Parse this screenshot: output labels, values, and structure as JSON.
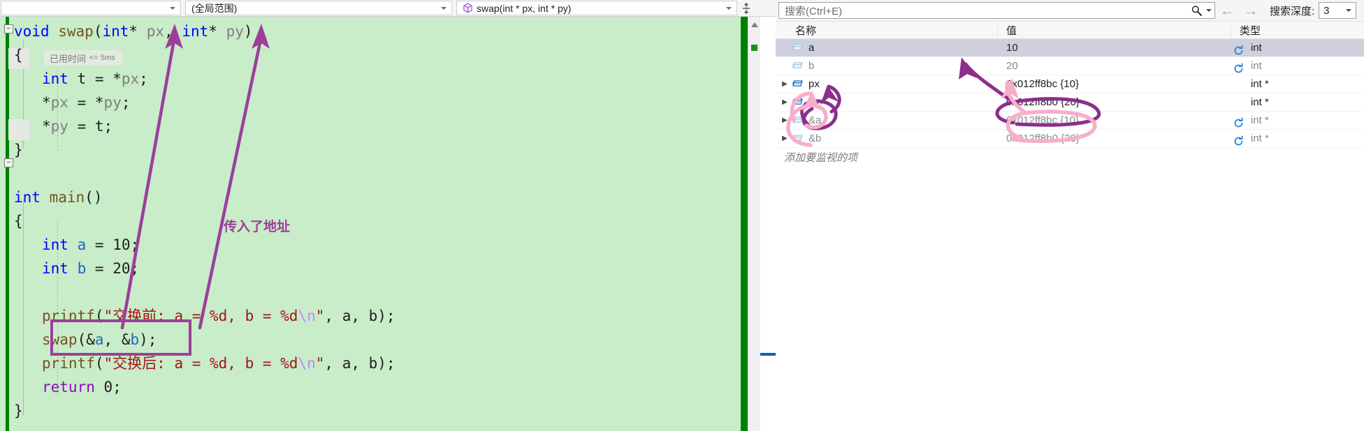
{
  "editor": {
    "nav": {
      "scope_combo_1": "",
      "scope_combo_2": "(全局范围)",
      "function_combo": "swap(int * px, int * py)",
      "cube_icon": "cube-icon",
      "split_icon": "split-window-icon"
    },
    "elapsed": {
      "label": "已用时间",
      "value": "<= 5ms"
    },
    "annotation": "传入了地址",
    "code": [
      {
        "indent": 0,
        "tokens": [
          {
            "t": "void",
            "c": "kw"
          },
          {
            "t": " ",
            "c": "punc"
          },
          {
            "t": "swap",
            "c": "fn"
          },
          {
            "t": "(",
            "c": "punc"
          },
          {
            "t": "int",
            "c": "kw"
          },
          {
            "t": "*",
            "c": "punc"
          },
          {
            "t": " ",
            "c": "punc"
          },
          {
            "t": "px",
            "c": "param"
          },
          {
            "t": ", ",
            "c": "punc"
          },
          {
            "t": "int",
            "c": "kw"
          },
          {
            "t": "*",
            "c": "punc"
          },
          {
            "t": " ",
            "c": "punc"
          },
          {
            "t": "py",
            "c": "param"
          },
          {
            "t": ")",
            "c": "punc"
          }
        ]
      },
      {
        "indent": 0,
        "tokens": [
          {
            "t": "{",
            "c": "punc"
          }
        ]
      },
      {
        "indent": 1,
        "tokens": [
          {
            "t": "int",
            "c": "kw"
          },
          {
            "t": " t = ",
            "c": "punc"
          },
          {
            "t": "*",
            "c": "punc"
          },
          {
            "t": "px",
            "c": "param"
          },
          {
            "t": ";",
            "c": "punc"
          }
        ]
      },
      {
        "indent": 1,
        "tokens": [
          {
            "t": "*",
            "c": "punc"
          },
          {
            "t": "px",
            "c": "param"
          },
          {
            "t": " = ",
            "c": "punc"
          },
          {
            "t": "*",
            "c": "punc"
          },
          {
            "t": "py",
            "c": "param"
          },
          {
            "t": ";",
            "c": "punc"
          }
        ]
      },
      {
        "indent": 1,
        "tokens": [
          {
            "t": "*",
            "c": "punc"
          },
          {
            "t": "py",
            "c": "param"
          },
          {
            "t": " = t;",
            "c": "punc"
          }
        ]
      },
      {
        "indent": 0,
        "tokens": [
          {
            "t": "}",
            "c": "punc"
          }
        ]
      },
      {
        "indent": 0,
        "tokens": []
      },
      {
        "indent": 0,
        "tokens": [
          {
            "t": "int",
            "c": "kw"
          },
          {
            "t": " ",
            "c": "punc"
          },
          {
            "t": "main",
            "c": "fn"
          },
          {
            "t": "()",
            "c": "punc"
          }
        ]
      },
      {
        "indent": 0,
        "tokens": [
          {
            "t": "{",
            "c": "punc"
          }
        ]
      },
      {
        "indent": 1,
        "tokens": [
          {
            "t": "int",
            "c": "kw"
          },
          {
            "t": " ",
            "c": "punc"
          },
          {
            "t": "a",
            "c": "var"
          },
          {
            "t": " = ",
            "c": "punc"
          },
          {
            "t": "10",
            "c": "num"
          },
          {
            "t": ";",
            "c": "punc"
          }
        ]
      },
      {
        "indent": 1,
        "tokens": [
          {
            "t": "int",
            "c": "kw"
          },
          {
            "t": " ",
            "c": "punc"
          },
          {
            "t": "b",
            "c": "var"
          },
          {
            "t": " = ",
            "c": "punc"
          },
          {
            "t": "20",
            "c": "num"
          },
          {
            "t": ";",
            "c": "punc"
          }
        ]
      },
      {
        "indent": 1,
        "tokens": []
      },
      {
        "indent": 1,
        "tokens": [
          {
            "t": "printf",
            "c": "fn"
          },
          {
            "t": "(",
            "c": "punc"
          },
          {
            "t": "\"交换前: a = %d, b = %d",
            "c": "str"
          },
          {
            "t": "\\n",
            "c": "esc"
          },
          {
            "t": "\"",
            "c": "str"
          },
          {
            "t": ", a, b);",
            "c": "punc"
          }
        ]
      },
      {
        "indent": 1,
        "tokens": [
          {
            "t": "swap",
            "c": "fn"
          },
          {
            "t": "(",
            "c": "punc"
          },
          {
            "t": "&",
            "c": "punc"
          },
          {
            "t": "a",
            "c": "var"
          },
          {
            "t": ", ",
            "c": "punc"
          },
          {
            "t": "&",
            "c": "punc"
          },
          {
            "t": "b",
            "c": "var"
          },
          {
            "t": ");",
            "c": "punc"
          }
        ]
      },
      {
        "indent": 1,
        "tokens": [
          {
            "t": "printf",
            "c": "fn"
          },
          {
            "t": "(",
            "c": "punc"
          },
          {
            "t": "\"交换后: a = %d, b = %d",
            "c": "str"
          },
          {
            "t": "\\n",
            "c": "esc"
          },
          {
            "t": "\"",
            "c": "str"
          },
          {
            "t": ", a, b);",
            "c": "punc"
          }
        ]
      },
      {
        "indent": 1,
        "tokens": [
          {
            "t": "return",
            "c": "ctrl"
          },
          {
            "t": " ",
            "c": "punc"
          },
          {
            "t": "0",
            "c": "num"
          },
          {
            "t": ";",
            "c": "punc"
          }
        ]
      },
      {
        "indent": 0,
        "tokens": [
          {
            "t": "}",
            "c": "punc"
          }
        ]
      }
    ]
  },
  "watch": {
    "search": {
      "placeholder": "搜索(Ctrl+E)",
      "icon": "magnifier-icon"
    },
    "nav_back": "←",
    "nav_forward": "→",
    "depth_label": "搜索深度:",
    "depth_value": "3",
    "columns": {
      "name": "名称",
      "value": "值",
      "type": "类型"
    },
    "rows": [
      {
        "name": "a",
        "value": "10",
        "type": "int",
        "expandable": false,
        "refresh": true,
        "dim": false,
        "selected": true
      },
      {
        "name": "b",
        "value": "20",
        "type": "int",
        "expandable": false,
        "refresh": true,
        "dim": true,
        "selected": false
      },
      {
        "name": "px",
        "value": "0x012ff8bc {10}",
        "type": "int *",
        "expandable": true,
        "refresh": false,
        "dim": false,
        "selected": false
      },
      {
        "name": "py",
        "value": "0x012ff8b0 {20}",
        "type": "int *",
        "expandable": true,
        "refresh": false,
        "dim": false,
        "selected": false
      },
      {
        "name": "&a",
        "value": "0x012ff8bc {10}",
        "type": "int *",
        "expandable": true,
        "refresh": true,
        "dim": true,
        "selected": false
      },
      {
        "name": "&b",
        "value": "0x012ff8b0 {20}",
        "type": "int *",
        "expandable": true,
        "refresh": true,
        "dim": true,
        "selected": false
      }
    ],
    "add_item_placeholder": "添加要监视的项"
  },
  "colors": {
    "code_bg": "#c9ecc9",
    "annotation_purple": "#9b3f9b",
    "annotation_pink": "#f7aec8",
    "annotation_dark_purple": "#8b2f8b",
    "selected_row": "#cfd0dd",
    "refresh_blue": "#1e7fd4"
  }
}
